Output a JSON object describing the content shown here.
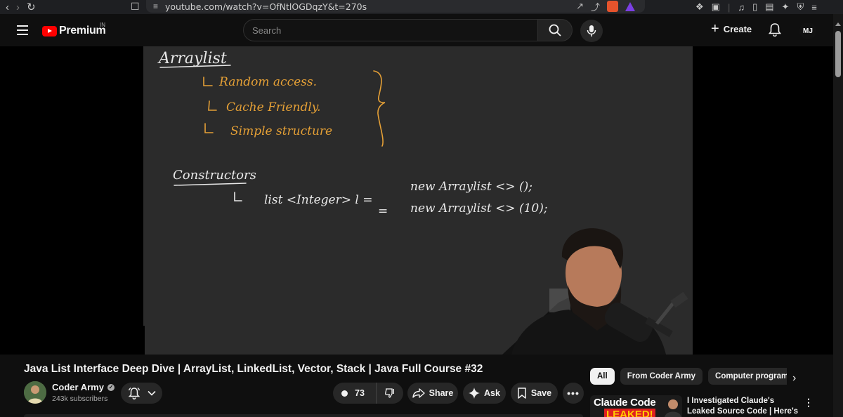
{
  "browser": {
    "url": "youtube.com/watch?v=OfNtlOGDqzY&t=270s"
  },
  "header": {
    "logo_text": "Premium",
    "country_code": "IN",
    "search_placeholder": "Search",
    "create_label": "Create",
    "avatar_initials": "MJ"
  },
  "whiteboard": {
    "heading1": "Arraylist",
    "points": [
      "Random access.",
      "Cache Friendly.",
      "Simple structure"
    ],
    "heading2": "Constructors",
    "line1_left": "list <Integer> l =",
    "line1_right": "new Arraylist <> ();",
    "line2_eq": "=",
    "line2_right": "new Arraylist <> (10);"
  },
  "video": {
    "title": "Java List Interface Deep Dive | ArrayList, LinkedList, Vector, Stack | Java Full Course #32",
    "channel_name": "Coder Army",
    "subscribers": "243k subscribers",
    "like_count": "73",
    "share_label": "Share",
    "ask_label": "Ask",
    "save_label": "Save",
    "more_label": "•••"
  },
  "filters": {
    "chips": [
      "All",
      "From Coder Army",
      "Computer programming"
    ]
  },
  "recommendation": {
    "thumb_line1": "Claude Code",
    "thumb_line2": "LEAKED!",
    "title": "I Investigated Claude's Leaked Source Code | Here's What I ..."
  },
  "colors": {
    "background": "#0f0f0f",
    "board": "#2b2b2b",
    "chalk_white": "#e8e8e8",
    "chalk_orange": "#e5a036",
    "brand_red": "#ff0000"
  }
}
